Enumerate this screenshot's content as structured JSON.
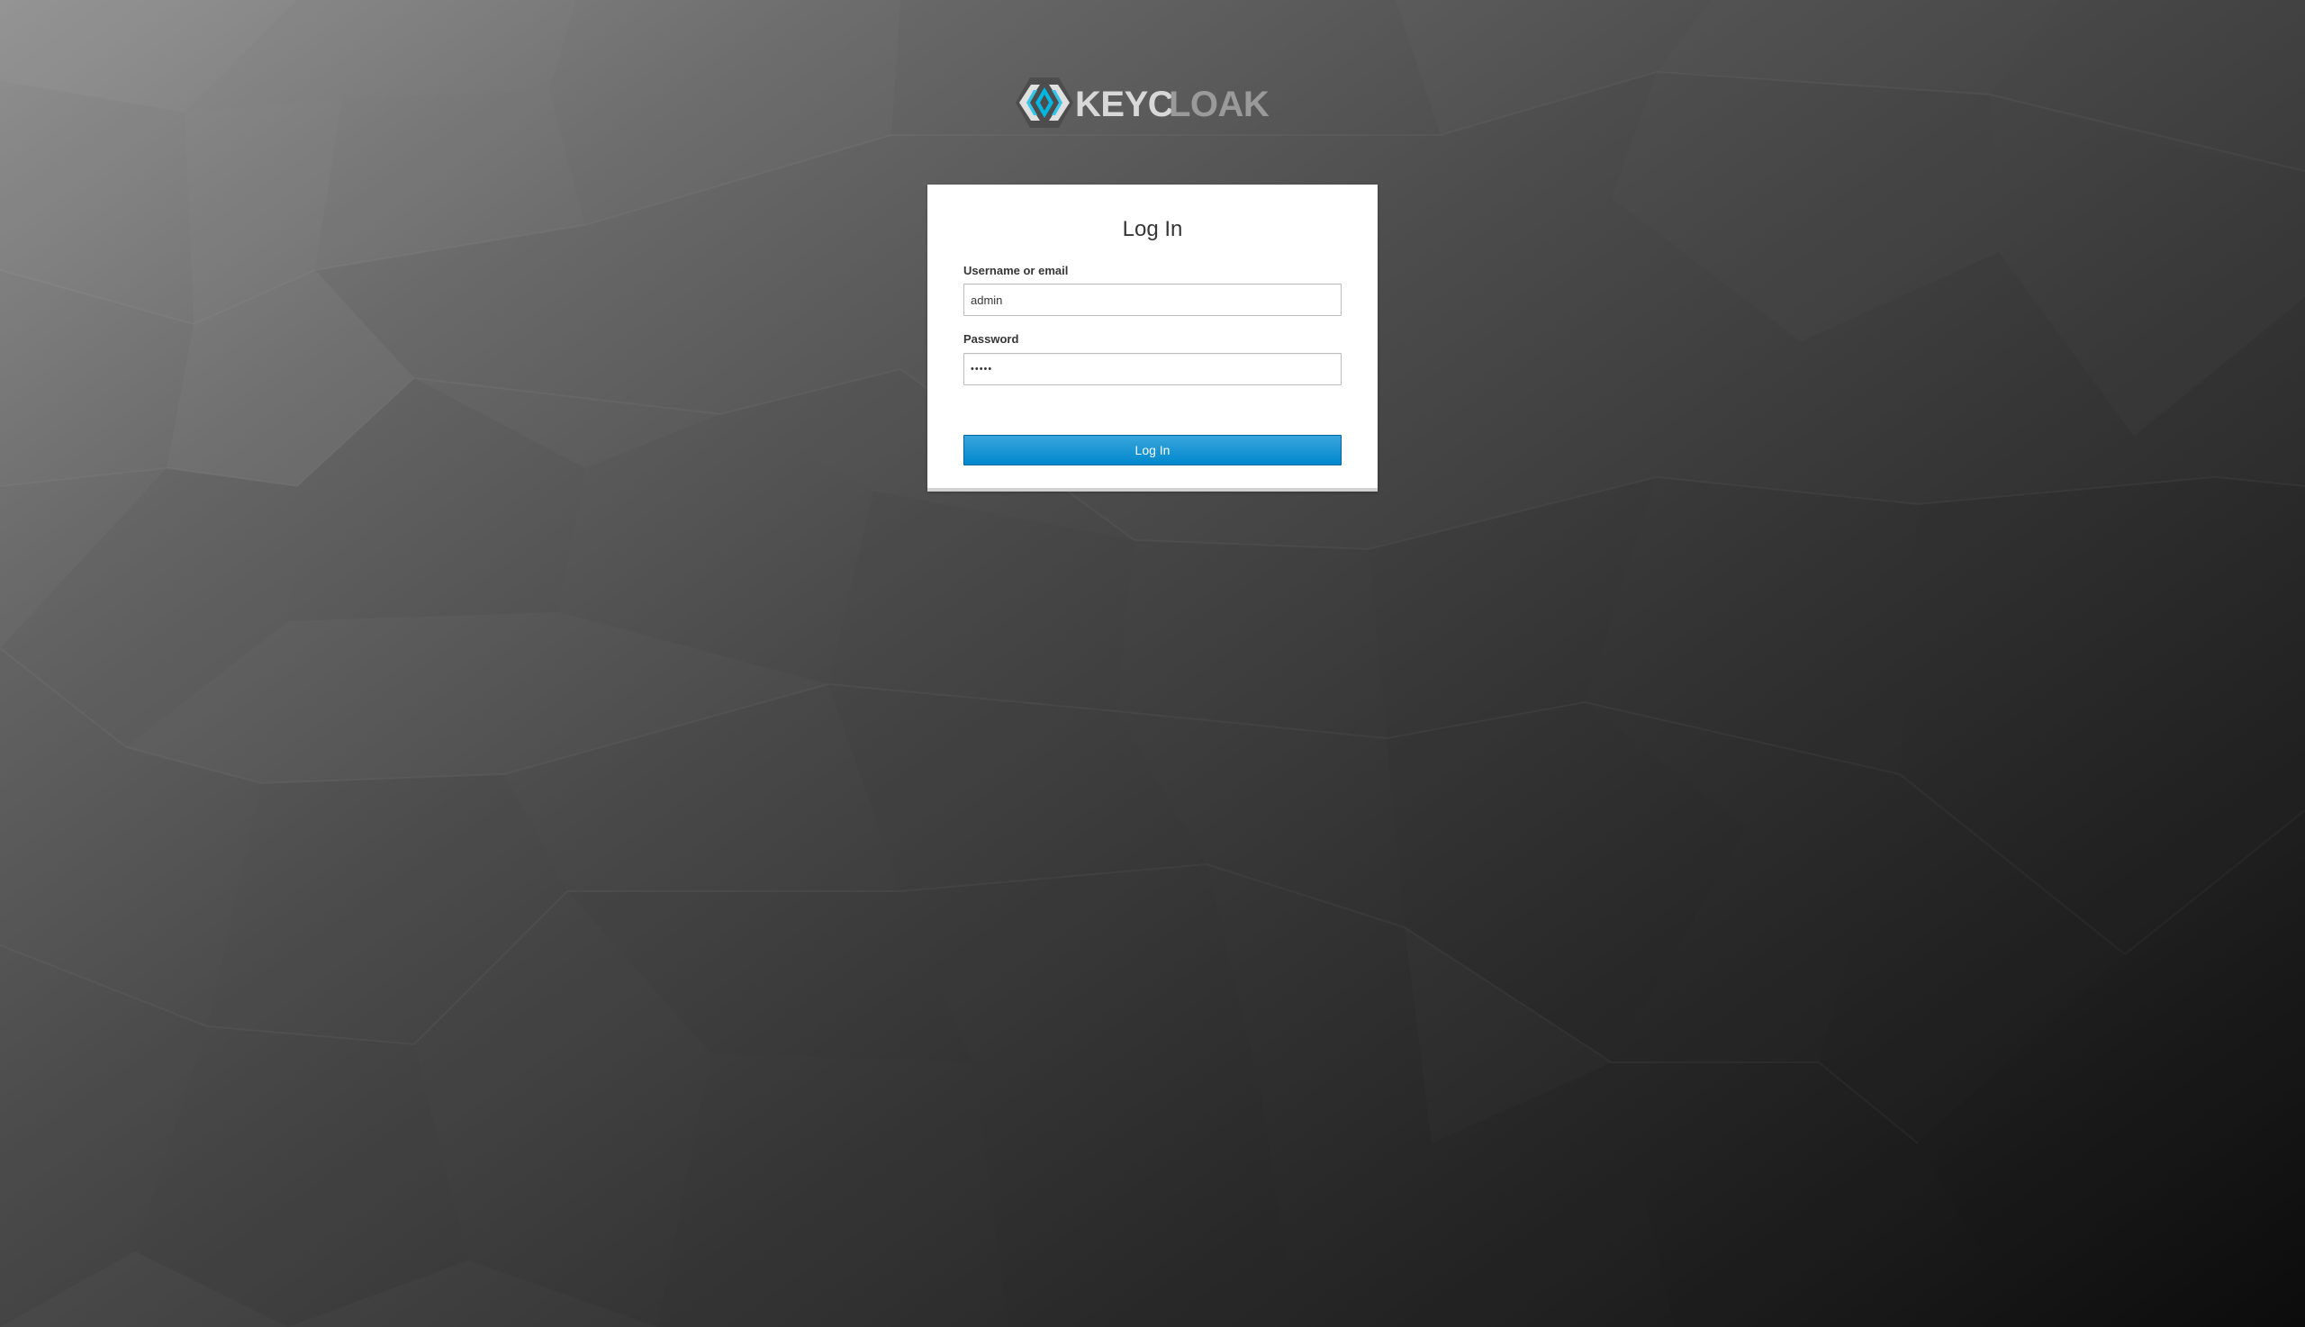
{
  "app": {
    "logo_text": "KEYCLOAK"
  },
  "login": {
    "title": "Log In",
    "username_label": "Username or email",
    "username_value": "admin",
    "password_label": "Password",
    "password_value": "•••••",
    "submit_label": "Log In"
  },
  "colors": {
    "primary_button": "#0088ce",
    "logo_accent": "#00b8e3",
    "card_background": "#ffffff"
  },
  "icons": {
    "logo_mark": "keycloak-hexagon-icon"
  }
}
